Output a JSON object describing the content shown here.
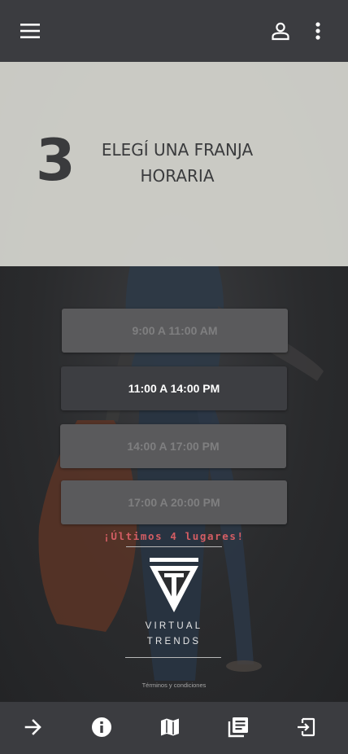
{
  "header": {
    "menu_icon": "menu-icon",
    "account_icon": "person-icon",
    "more_icon": "more-vertical-icon"
  },
  "step": {
    "number": "3",
    "title": "ELEGÍ UNA FRANJA HORARIA"
  },
  "time_slots": [
    {
      "label": "9:00 A 11:00 AM",
      "state": "disabled"
    },
    {
      "label": "11:00 A 14:00 PM",
      "state": "available"
    },
    {
      "label": "14:00 A 17:00 PM",
      "state": "disabled"
    },
    {
      "label": "17:00 A 20:00 PM",
      "state": "disabled"
    }
  ],
  "promo_text": "¡Últimos 4 lugares!",
  "brand": {
    "line1": "VIRTUAL",
    "line2": "TRENDS"
  },
  "footer_link": "Términos y condiciones",
  "bottom_nav": [
    {
      "icon": "arrow-right-icon"
    },
    {
      "icon": "info-icon"
    },
    {
      "icon": "map-icon"
    },
    {
      "icon": "library-books-icon"
    },
    {
      "icon": "exit-icon"
    }
  ],
  "colors": {
    "bar": "#3b3c40",
    "promo": "#d35d63",
    "hero_overlay": "#d6d6d0"
  }
}
